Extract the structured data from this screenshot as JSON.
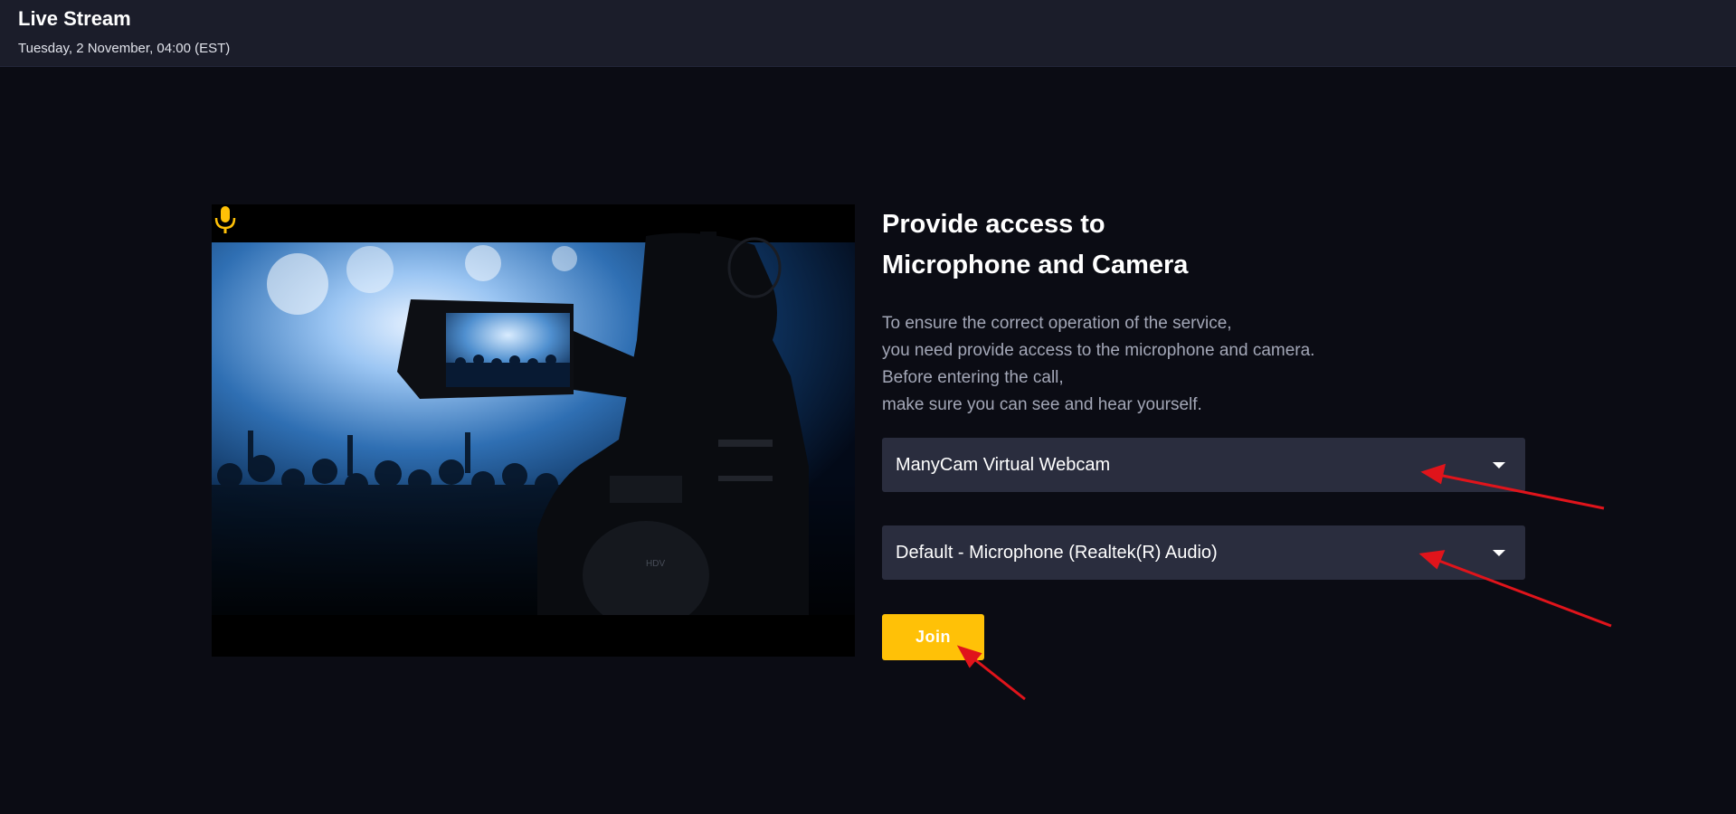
{
  "header": {
    "title": "Live Stream",
    "date": "Tuesday, 2 November, 04:00 (EST)"
  },
  "preview": {
    "image": "camera-filming-concert",
    "mic_icon": "microphone-icon",
    "mic_color": "#ffc107"
  },
  "panel": {
    "heading_line1": "Provide access to",
    "heading_line2": "Microphone and Camera",
    "description": [
      "To ensure the correct operation of the service,",
      "you need provide access to the microphone and camera.",
      "Before entering the call,",
      "make sure you can see and hear yourself."
    ],
    "camera_select": {
      "value": "ManyCam Virtual Webcam",
      "icon": "chevron-down-icon"
    },
    "microphone_select": {
      "value": "Default - Microphone (Realtek(R) Audio)",
      "icon": "chevron-down-icon"
    },
    "join_label": "Join"
  },
  "colors": {
    "background": "#0b0c14",
    "topbar": "#1b1d2a",
    "select_bg": "#2a2d3e",
    "accent": "#ffc107",
    "annotation": "#e0141b"
  }
}
